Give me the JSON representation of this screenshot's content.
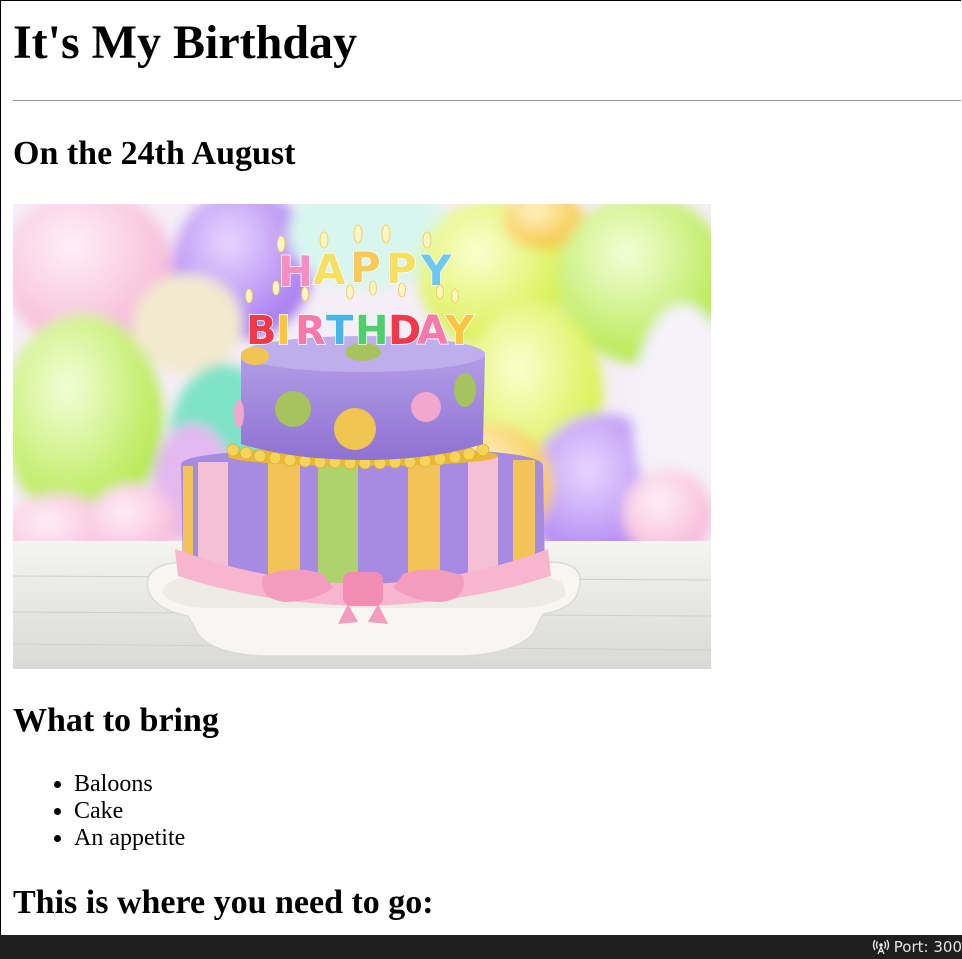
{
  "page": {
    "title": "It's My Birthday",
    "date_heading": "On the 24th August",
    "image": {
      "candle_letters_top": [
        "H",
        "A",
        "P",
        "P",
        "Y"
      ],
      "candle_letters_bottom": [
        "B",
        "I",
        "R",
        "T",
        "H",
        "D",
        "A",
        "Y"
      ]
    },
    "bring_heading": "What to bring",
    "bring_items": [
      "Baloons",
      "Cake",
      "An appetite"
    ],
    "go_heading": "This is where you need to go:"
  },
  "statusbar": {
    "port_label": "Port: 300",
    "port_icon": "broadcast-icon"
  },
  "colors": {
    "statusbar_bg": "#1e1e1e",
    "divider": "#9a9a9a"
  }
}
